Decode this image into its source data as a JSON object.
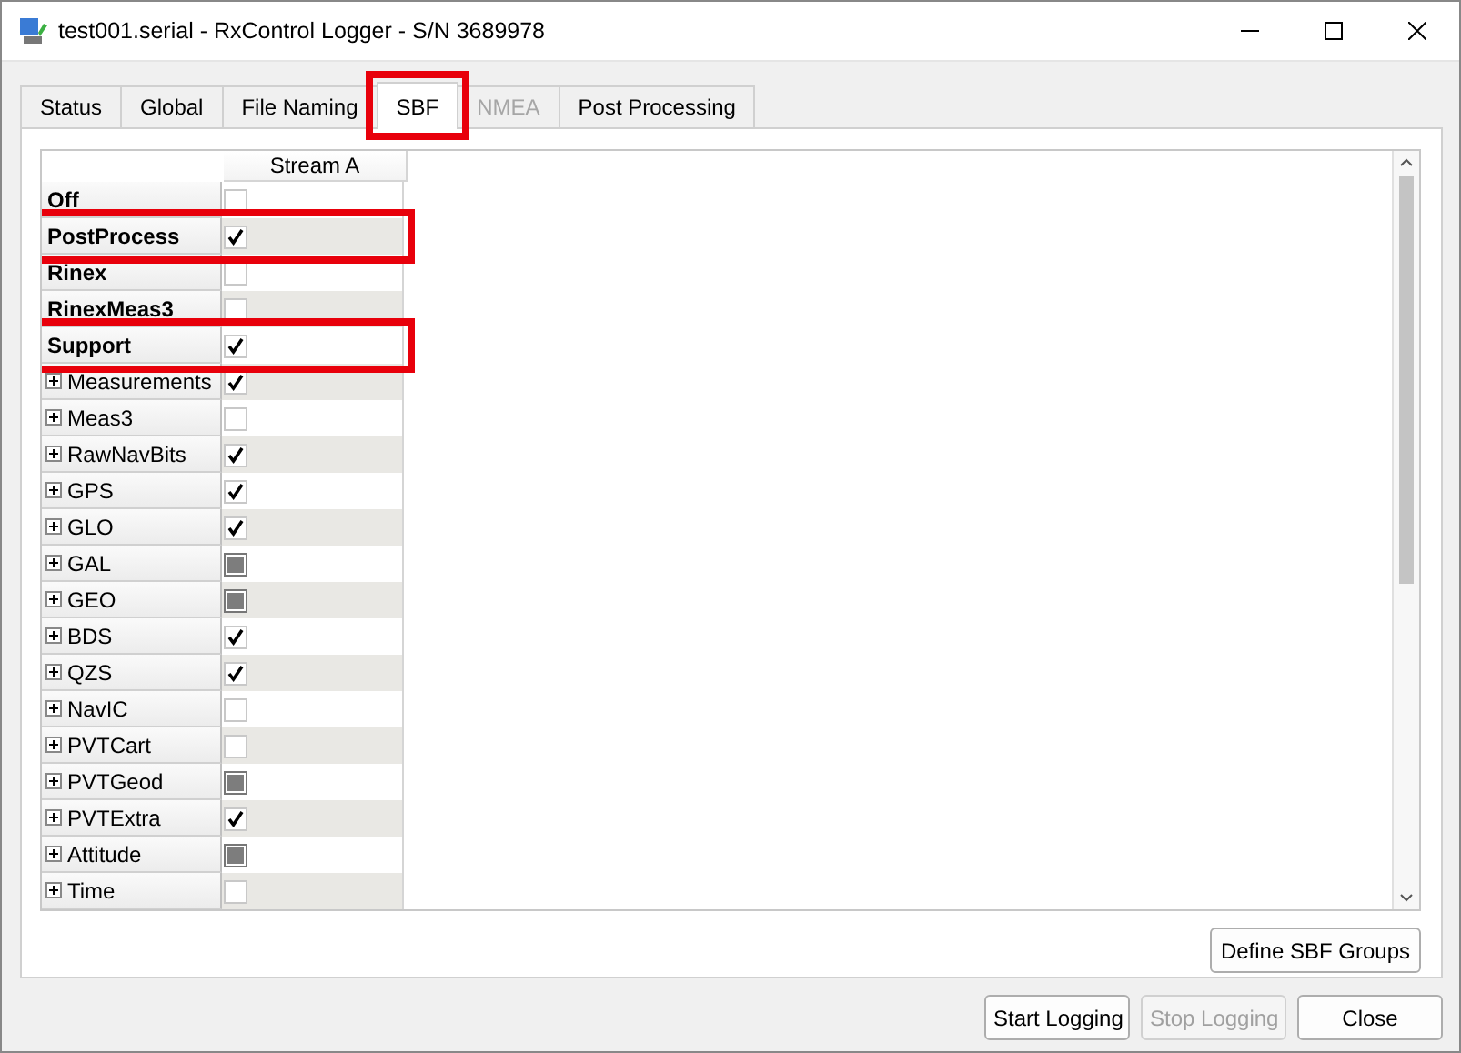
{
  "window": {
    "title": "test001.serial - RxControl Logger - S/N 3689978"
  },
  "tabs": [
    {
      "label": "Status",
      "selected": false,
      "disabled": false,
      "highlighted": false
    },
    {
      "label": "Global",
      "selected": false,
      "disabled": false,
      "highlighted": false
    },
    {
      "label": "File Naming",
      "selected": false,
      "disabled": false,
      "highlighted": false
    },
    {
      "label": "SBF",
      "selected": true,
      "disabled": false,
      "highlighted": true
    },
    {
      "label": "NMEA",
      "selected": false,
      "disabled": true,
      "highlighted": false
    },
    {
      "label": "Post Processing",
      "selected": false,
      "disabled": false,
      "highlighted": false
    }
  ],
  "table": {
    "columns": [
      "Stream A"
    ],
    "rows": [
      {
        "name": "Off",
        "kind": "leaf",
        "checked": false,
        "mixed": false,
        "highlighted": false
      },
      {
        "name": "PostProcess",
        "kind": "leaf",
        "checked": true,
        "mixed": false,
        "highlighted": true
      },
      {
        "name": "Rinex",
        "kind": "leaf",
        "checked": false,
        "mixed": false,
        "highlighted": false
      },
      {
        "name": "RinexMeas3",
        "kind": "leaf",
        "checked": false,
        "mixed": false,
        "highlighted": false
      },
      {
        "name": "Support",
        "kind": "leaf",
        "checked": true,
        "mixed": false,
        "highlighted": true
      },
      {
        "name": "Measurements",
        "kind": "group",
        "checked": true,
        "mixed": false,
        "highlighted": false
      },
      {
        "name": "Meas3",
        "kind": "group",
        "checked": false,
        "mixed": false,
        "highlighted": false
      },
      {
        "name": "RawNavBits",
        "kind": "group",
        "checked": true,
        "mixed": false,
        "highlighted": false
      },
      {
        "name": "GPS",
        "kind": "group",
        "checked": true,
        "mixed": false,
        "highlighted": false
      },
      {
        "name": "GLO",
        "kind": "group",
        "checked": true,
        "mixed": false,
        "highlighted": false
      },
      {
        "name": "GAL",
        "kind": "group",
        "checked": false,
        "mixed": true,
        "highlighted": false
      },
      {
        "name": "GEO",
        "kind": "group",
        "checked": false,
        "mixed": true,
        "highlighted": false
      },
      {
        "name": "BDS",
        "kind": "group",
        "checked": true,
        "mixed": false,
        "highlighted": false
      },
      {
        "name": "QZS",
        "kind": "group",
        "checked": true,
        "mixed": false,
        "highlighted": false
      },
      {
        "name": "NavIC",
        "kind": "group",
        "checked": false,
        "mixed": false,
        "highlighted": false
      },
      {
        "name": "PVTCart",
        "kind": "group",
        "checked": false,
        "mixed": false,
        "highlighted": false
      },
      {
        "name": "PVTGeod",
        "kind": "group",
        "checked": false,
        "mixed": true,
        "highlighted": false
      },
      {
        "name": "PVTExtra",
        "kind": "group",
        "checked": true,
        "mixed": false,
        "highlighted": false
      },
      {
        "name": "Attitude",
        "kind": "group",
        "checked": false,
        "mixed": true,
        "highlighted": false
      },
      {
        "name": "Time",
        "kind": "group",
        "checked": false,
        "mixed": false,
        "highlighted": false
      }
    ]
  },
  "panel_button": {
    "label": "Define SBF Groups",
    "disabled": false
  },
  "buttons": [
    {
      "label": "Start Logging",
      "disabled": false
    },
    {
      "label": "Stop Logging",
      "disabled": true
    },
    {
      "label": "Close",
      "disabled": false
    }
  ]
}
